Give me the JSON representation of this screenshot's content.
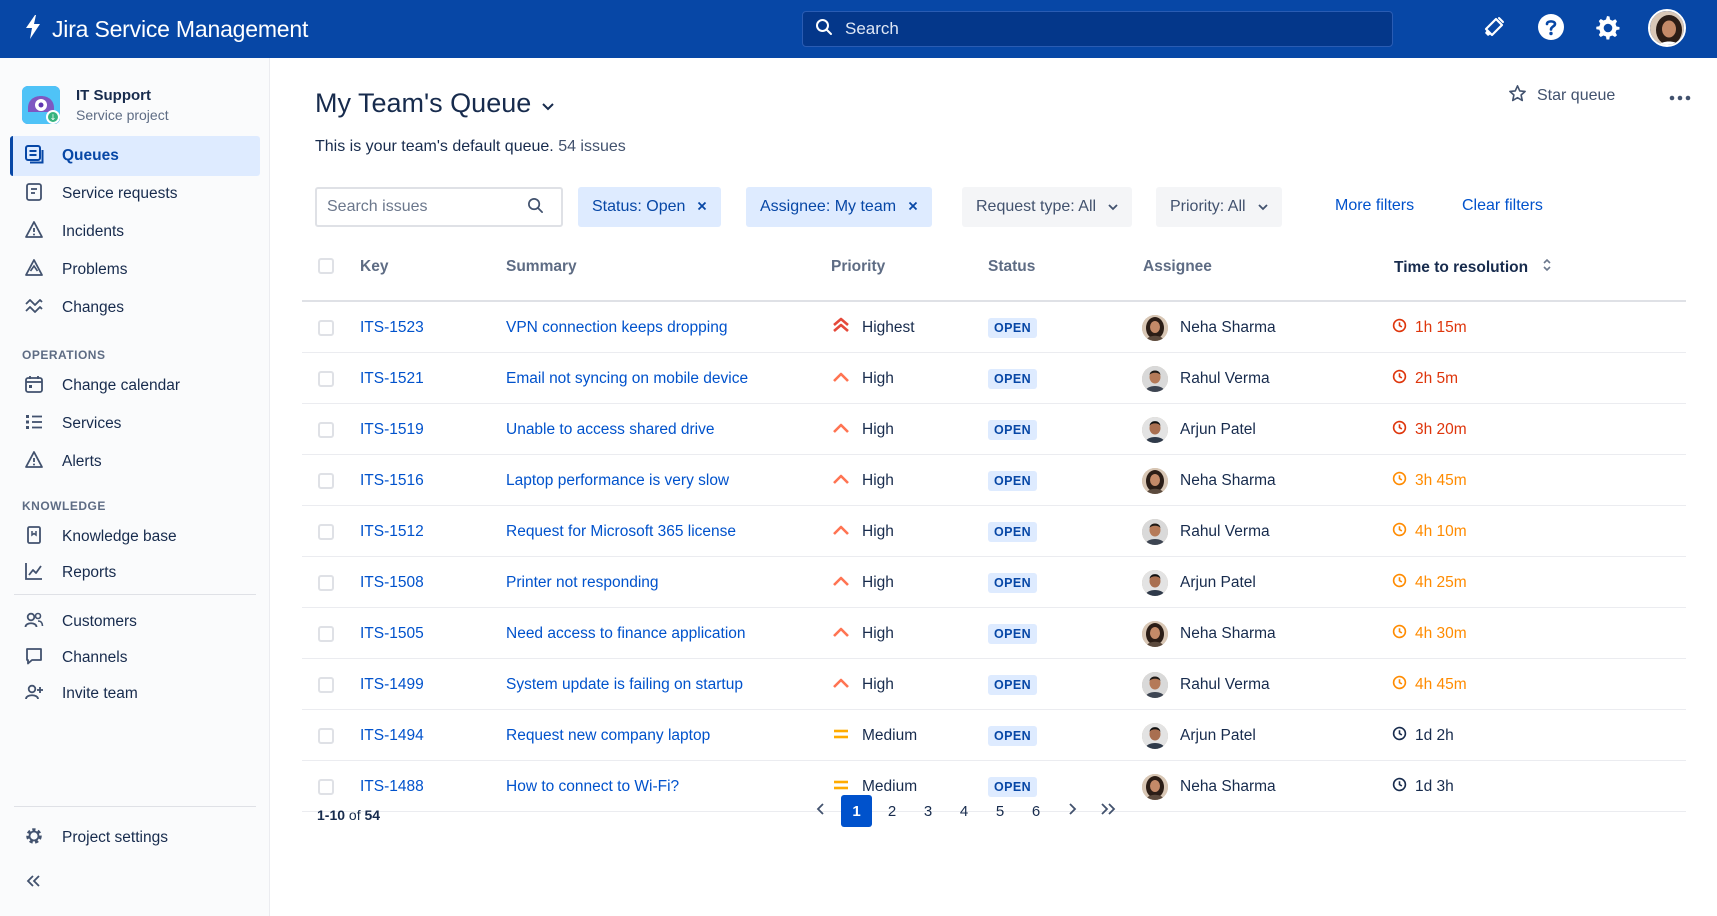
{
  "app": {
    "title": "Jira Service Management"
  },
  "search": {
    "placeholder": "Search"
  },
  "colors": {
    "topbar": "#0747a6",
    "link": "#0052cc",
    "highest": "#e5493a",
    "high": "#ff7452",
    "medium": "#ffab00",
    "timer_red": "#de350b",
    "timer_orange": "#ff8b00"
  },
  "project": {
    "name": "IT Support",
    "type": "Service project"
  },
  "sidebar": {
    "items": [
      {
        "label": "Queues",
        "icon": "queue-icon"
      },
      {
        "label": "Service requests",
        "icon": "service-request-icon"
      },
      {
        "label": "Incidents",
        "icon": "incident-icon"
      },
      {
        "label": "Problems",
        "icon": "problem-icon"
      },
      {
        "label": "Changes",
        "icon": "changes-icon"
      }
    ],
    "operations_title": "OPERATIONS",
    "operations": [
      {
        "label": "Change calendar",
        "icon": "calendar-icon"
      },
      {
        "label": "Services",
        "icon": "services-icon"
      },
      {
        "label": "Alerts",
        "icon": "alert-icon"
      }
    ],
    "knowledge_title": "KNOWLEDGE",
    "knowledge": [
      {
        "label": "Knowledge base",
        "icon": "knowledge-base-icon"
      },
      {
        "label": "Reports",
        "icon": "reports-icon"
      }
    ],
    "people": [
      {
        "label": "Customers",
        "icon": "customers-icon"
      },
      {
        "label": "Channels",
        "icon": "channels-icon"
      },
      {
        "label": "Invite team",
        "icon": "invite-icon"
      }
    ],
    "settings": {
      "label": "Project settings",
      "icon": "gear-icon"
    }
  },
  "queue": {
    "title": "My Team's Queue",
    "description": "This is your team's default queue.",
    "issue_count": "54 issues",
    "star_label": "Star queue",
    "search_placeholder": "Search issues"
  },
  "filters": {
    "status": "Status: Open",
    "assignee": "Assignee: My team",
    "request_type": "Request type: All",
    "priority": "Priority: All",
    "more": "More filters",
    "clear": "Clear filters"
  },
  "table": {
    "headers": {
      "key": "Key",
      "summary": "Summary",
      "priority": "Priority",
      "status": "Status",
      "assignee": "Assignee",
      "time": "Time to resolution"
    },
    "rows": [
      {
        "key": "ITS-1523",
        "summary": "VPN connection keeps dropping",
        "priority": "Highest",
        "priority_level": "highest",
        "status": "OPEN",
        "assignee": "Neha Sharma",
        "time": "1h 15m",
        "time_state": "red"
      },
      {
        "key": "ITS-1521",
        "summary": "Email not syncing on mobile device",
        "priority": "High",
        "priority_level": "high",
        "status": "OPEN",
        "assignee": "Rahul Verma",
        "time": "2h 5m",
        "time_state": "red"
      },
      {
        "key": "ITS-1519",
        "summary": "Unable to access shared drive",
        "priority": "High",
        "priority_level": "high",
        "status": "OPEN",
        "assignee": "Arjun Patel",
        "time": "3h 20m",
        "time_state": "red"
      },
      {
        "key": "ITS-1516",
        "summary": "Laptop performance is very slow",
        "priority": "High",
        "priority_level": "high",
        "status": "OPEN",
        "assignee": "Neha Sharma",
        "time": "3h 45m",
        "time_state": "orange"
      },
      {
        "key": "ITS-1512",
        "summary": "Request for Microsoft 365 license",
        "priority": "High",
        "priority_level": "high",
        "status": "OPEN",
        "assignee": "Rahul Verma",
        "time": "4h 10m",
        "time_state": "orange"
      },
      {
        "key": "ITS-1508",
        "summary": "Printer not responding",
        "priority": "High",
        "priority_level": "high",
        "status": "OPEN",
        "assignee": "Arjun Patel",
        "time": "4h 25m",
        "time_state": "orange"
      },
      {
        "key": "ITS-1505",
        "summary": "Need access to finance application",
        "priority": "High",
        "priority_level": "high",
        "status": "OPEN",
        "assignee": "Neha Sharma",
        "time": "4h 30m",
        "time_state": "orange"
      },
      {
        "key": "ITS-1499",
        "summary": "System update is failing on startup",
        "priority": "High",
        "priority_level": "high",
        "status": "OPEN",
        "assignee": "Rahul Verma",
        "time": "4h 45m",
        "time_state": "orange"
      },
      {
        "key": "ITS-1494",
        "summary": "Request new company laptop",
        "priority": "Medium",
        "priority_level": "medium",
        "status": "OPEN",
        "assignee": "Arjun Patel",
        "time": "1d 2h",
        "time_state": "neutral"
      },
      {
        "key": "ITS-1488",
        "summary": "How to connect to Wi-Fi?",
        "priority": "Medium",
        "priority_level": "medium",
        "status": "OPEN",
        "assignee": "Neha Sharma",
        "time": "1d 3h",
        "time_state": "neutral"
      }
    ]
  },
  "pagination": {
    "range": "1-10",
    "of_label": "of",
    "total": "54",
    "pages": [
      "1",
      "2",
      "3",
      "4",
      "5",
      "6"
    ],
    "current": "1"
  }
}
